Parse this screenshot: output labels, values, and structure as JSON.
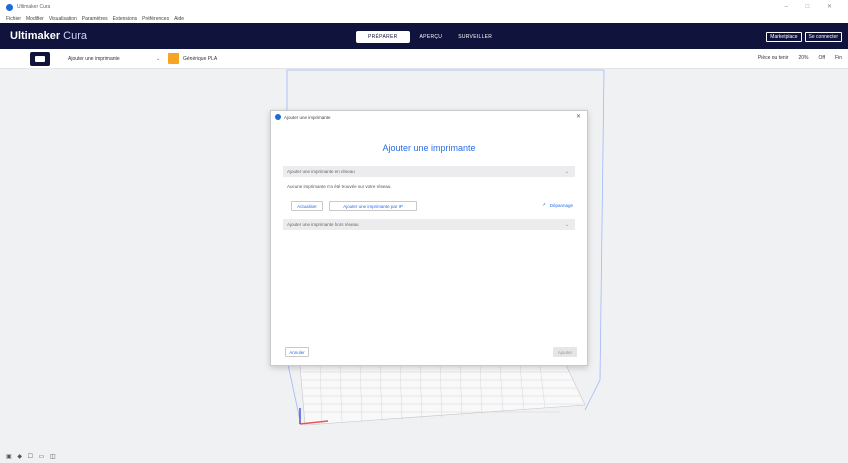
{
  "window": {
    "title": "Ultimaker Cura",
    "controls": "–   □   ✕"
  },
  "menu": [
    "Fichier",
    "Modifier",
    "Visualisation",
    "Paramètres",
    "Extensions",
    "Préférences",
    "Aide"
  ],
  "header": {
    "brand": "Ultimaker",
    "brand_sub": "Cura",
    "stages": [
      "PRÉPARER",
      "APERÇU",
      "SURVEILLER"
    ],
    "marketplace": "Marketplace",
    "signin": "Se connecter"
  },
  "toolbar": {
    "printer": "Ajouter une imprimante",
    "material": "Générique PLA",
    "support": "Pièce ou tenir",
    "infill": "20%",
    "adhesion": "Off",
    "quality": "Fin"
  },
  "bottom_tools": "▣ ◆ ☐ ▭ ◫",
  "dialog": {
    "window_title": "Ajouter une imprimante",
    "heading": "Ajouter une imprimante",
    "network_section": "Ajouter une imprimante en réseau",
    "network_info": "Aucune imprimante n'a été trouvée sur votre réseau.",
    "refresh_label": "Actualiser",
    "byip_label": "Ajouter une imprimante par IP",
    "troubleshoot": "Dépannage",
    "local_section": "Ajouter une imprimante hors réseau",
    "cancel_label": "Annuler",
    "add_label": "Ajouter"
  }
}
